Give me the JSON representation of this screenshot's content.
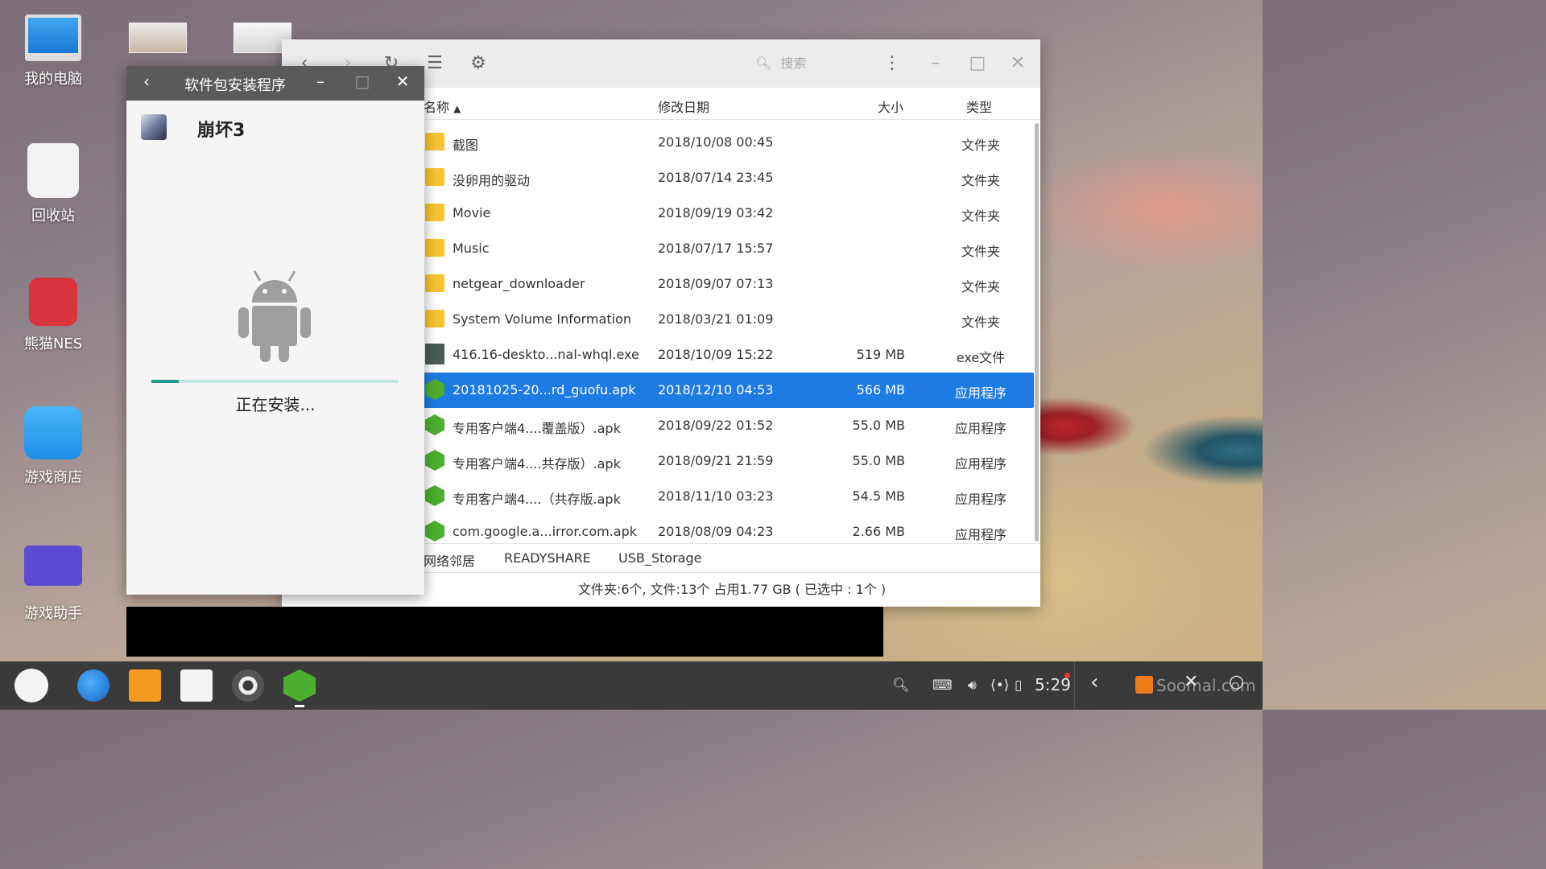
{
  "desktop": {
    "icons": [
      {
        "label": "我的电脑",
        "icon": "computer-icon"
      },
      {
        "label": "回收站",
        "icon": "trash-icon"
      },
      {
        "label": "熊猫NES",
        "icon": "panda-nes-icon"
      },
      {
        "label": "游戏商店",
        "icon": "game-store-icon"
      },
      {
        "label": "游戏助手",
        "icon": "game-assistant-icon"
      }
    ]
  },
  "installer": {
    "title": "软件包安装程序",
    "app_name": "崩坏3",
    "status": "正在安装...",
    "progress": 0.11,
    "accent": "#1d9c8e"
  },
  "file_manager": {
    "search_placeholder": "搜索",
    "columns": {
      "name": "名称",
      "date": "修改日期",
      "size": "大小",
      "type": "类型"
    },
    "rows": [
      {
        "name": "截图",
        "date": "2018/10/08 00:45",
        "size": "",
        "type": "文件夹",
        "kind": "folder"
      },
      {
        "name": "没卵用的驱动",
        "date": "2018/07/14 23:45",
        "size": "",
        "type": "文件夹",
        "kind": "folder"
      },
      {
        "name": "Movie",
        "date": "2018/09/19 03:42",
        "size": "",
        "type": "文件夹",
        "kind": "folder"
      },
      {
        "name": "Music",
        "date": "2018/07/17 15:57",
        "size": "",
        "type": "文件夹",
        "kind": "folder"
      },
      {
        "name": "netgear_downloader",
        "date": "2018/09/07 07:13",
        "size": "",
        "type": "文件夹",
        "kind": "folder"
      },
      {
        "name": "System Volume Information",
        "date": "2018/03/21 01:09",
        "size": "",
        "type": "文件夹",
        "kind": "folder"
      },
      {
        "name": "416.16-deskto...nal-whql.exe",
        "date": "2018/10/09 15:22",
        "size": "519 MB",
        "type": "exe文件",
        "kind": "exe"
      },
      {
        "name": "20181025-20...rd_guofu.apk",
        "date": "2018/12/10 04:53",
        "size": "566 MB",
        "type": "应用程序",
        "kind": "apk",
        "selected": true
      },
      {
        "name": "专用客户端4....覆盖版）.apk",
        "date": "2018/09/22 01:52",
        "size": "55.0 MB",
        "type": "应用程序",
        "kind": "apk"
      },
      {
        "name": "专用客户端4....共存版）.apk",
        "date": "2018/09/21 21:59",
        "size": "55.0 MB",
        "type": "应用程序",
        "kind": "apk"
      },
      {
        "name": "专用客户端4....（共存版.apk",
        "date": "2018/11/10 03:23",
        "size": "54.5 MB",
        "type": "应用程序",
        "kind": "apk"
      },
      {
        "name": "com.google.a...irror.com.apk",
        "date": "2018/08/09 04:23",
        "size": "2.66 MB",
        "type": "应用程序",
        "kind": "apk"
      }
    ],
    "breadcrumbs": [
      "网络邻居",
      "READYSHARE",
      "USB_Storage"
    ],
    "status": "文件夹:6个, 文件:13个 占用1.77 GB ( 已选中 : 1个 )",
    "selection_color": "#1e7be3"
  },
  "taskbar": {
    "apps": [
      "start-icon",
      "browser-icon",
      "file-manager-icon",
      "notes-icon",
      "settings-icon",
      "android-installer-icon"
    ],
    "time": "5:29",
    "watermark": "Soomal.com"
  }
}
